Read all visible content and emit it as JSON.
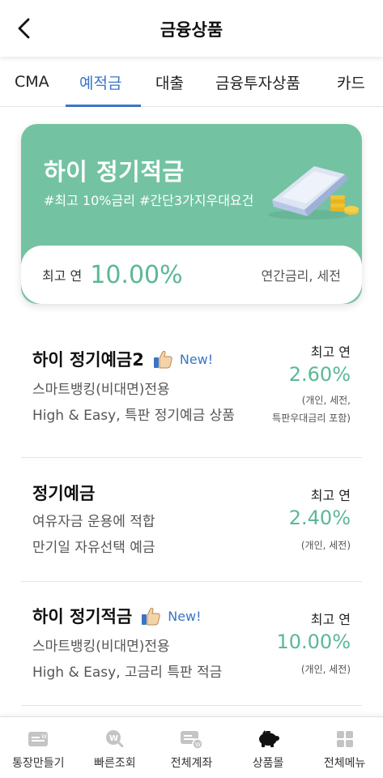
{
  "header": {
    "title": "금융상품"
  },
  "tabs": [
    {
      "label": "CMA"
    },
    {
      "label": "예적금",
      "active": true
    },
    {
      "label": "대출"
    },
    {
      "label": "금융투자상품"
    },
    {
      "label": "카드"
    }
  ],
  "promo": {
    "title": "하이 정기적금",
    "tags": "#최고 10%금리 #간단3가지우대요건",
    "rate_label": "최고 연",
    "rate": "10.00%",
    "note": "연간금리, 세전",
    "color": "#73c3a3"
  },
  "products": [
    {
      "name": "하이 정기예금2",
      "new_badge": "New!",
      "desc1": "스마트뱅킹(비대면)전용",
      "desc2": "High & Easy, 특판 정기예금 상품",
      "rate_label": "최고 연",
      "rate": "2.60%",
      "note1": "(개인, 세전,",
      "note2": "특판우대금리 포함)"
    },
    {
      "name": "정기예금",
      "desc1": "여유자금 운용에 적합",
      "desc2": "만기일 자유선택 예금",
      "rate_label": "최고 연",
      "rate": "2.40%",
      "note1": "(개인, 세전)"
    },
    {
      "name": "하이 정기적금",
      "new_badge": "New!",
      "desc1": "스마트뱅킹(비대면)전용",
      "desc2": "High & Easy, 고금리 특판 적금",
      "rate_label": "최고 연",
      "rate": "10.00%",
      "note1": "(개인, 세전)"
    }
  ],
  "bottom_nav": [
    {
      "label": "통장만들기",
      "icon": "passbook-icon"
    },
    {
      "label": "빠른조회",
      "icon": "quick-search-icon"
    },
    {
      "label": "전체계좌",
      "icon": "all-accounts-icon"
    },
    {
      "label": "상품몰",
      "icon": "piggy-bank-icon",
      "active": true
    },
    {
      "label": "전체메뉴",
      "icon": "grid-menu-icon"
    }
  ],
  "colors": {
    "accent_blue": "#3a75c4",
    "accent_green": "#5bb895",
    "promo_green": "#73c3a3"
  }
}
